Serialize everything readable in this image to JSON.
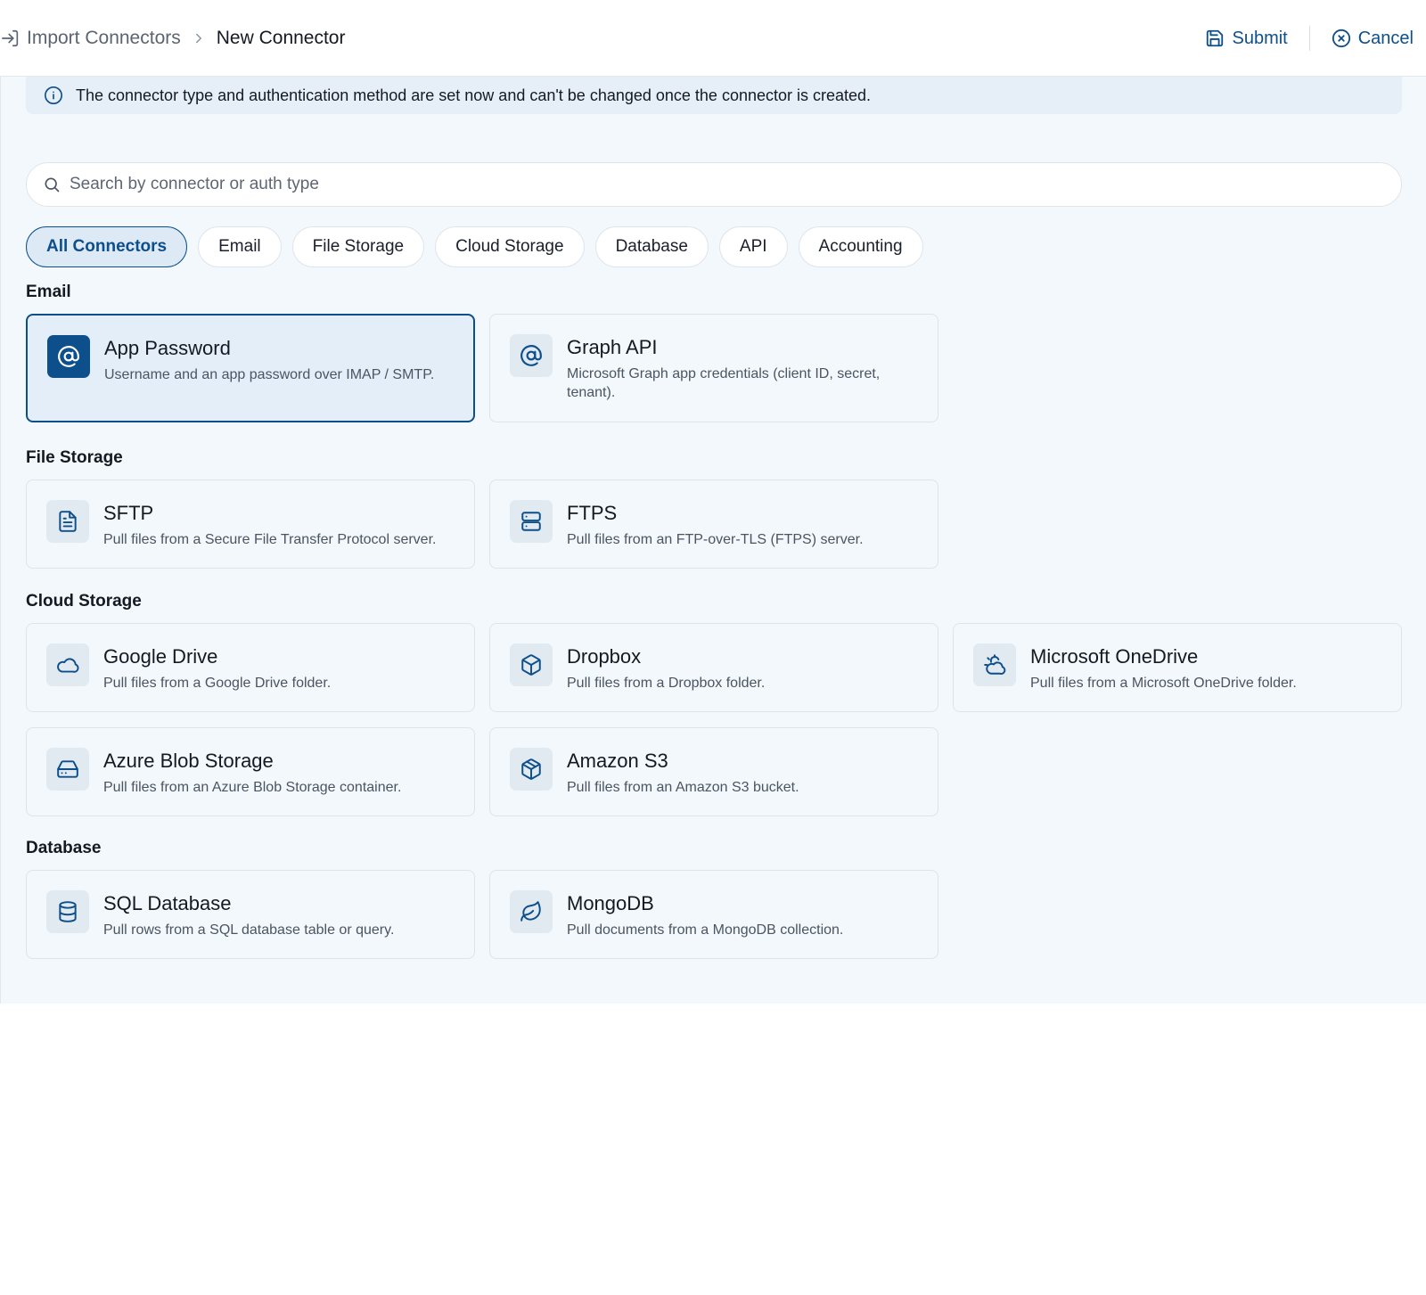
{
  "header": {
    "breadcrumb_parent": "Import Connectors",
    "breadcrumb_current": "New Connector",
    "submit_label": "Submit",
    "cancel_label": "Cancel"
  },
  "notice": {
    "text": "The connector type and authentication method are set now and can't be changed once the connector is created."
  },
  "search": {
    "placeholder": "Search by connector or auth type",
    "value": ""
  },
  "filters": [
    {
      "label": "All Connectors",
      "active": true
    },
    {
      "label": "Email",
      "active": false
    },
    {
      "label": "File Storage",
      "active": false
    },
    {
      "label": "Cloud Storage",
      "active": false
    },
    {
      "label": "Database",
      "active": false
    },
    {
      "label": "API",
      "active": false
    },
    {
      "label": "Accounting",
      "active": false
    }
  ],
  "sections": {
    "email": {
      "title": "Email",
      "items": [
        {
          "title": "App Password",
          "desc": "Username and an app password over IMAP / SMTP.",
          "icon": "at-sign-icon",
          "selected": true
        },
        {
          "title": "Graph API",
          "desc": "Microsoft Graph app credentials (client ID, secret, tenant).",
          "icon": "at-sign-icon",
          "selected": false
        }
      ]
    },
    "file_storage": {
      "title": "File Storage",
      "items": [
        {
          "title": "SFTP",
          "desc": "Pull files from a Secure File Transfer Protocol server.",
          "icon": "file-text-icon"
        },
        {
          "title": "FTPS",
          "desc": "Pull files from an FTP-over-TLS (FTPS) server.",
          "icon": "server-icon"
        }
      ]
    },
    "cloud_storage": {
      "title": "Cloud Storage",
      "items": [
        {
          "title": "Google Drive",
          "desc": "Pull files from a Google Drive folder.",
          "icon": "cloud-icon"
        },
        {
          "title": "Dropbox",
          "desc": "Pull files from a Dropbox folder.",
          "icon": "box-icon"
        },
        {
          "title": "Microsoft OneDrive",
          "desc": "Pull files from a Microsoft OneDrive folder.",
          "icon": "cloud-sun-icon"
        },
        {
          "title": "Azure Blob Storage",
          "desc": "Pull files from an Azure Blob Storage container.",
          "icon": "hard-drive-icon"
        },
        {
          "title": "Amazon S3",
          "desc": "Pull files from an Amazon S3 bucket.",
          "icon": "package-icon"
        }
      ]
    },
    "database": {
      "title": "Database",
      "items": [
        {
          "title": "SQL Database",
          "desc": "Pull rows from a SQL database table or query.",
          "icon": "database-icon"
        },
        {
          "title": "MongoDB",
          "desc": "Pull documents from a MongoDB collection.",
          "icon": "leaf-icon"
        }
      ]
    }
  },
  "colors": {
    "accent": "#0d4f8b",
    "page_background": "#f3f8fc",
    "notice_background": "#e6eff8"
  }
}
